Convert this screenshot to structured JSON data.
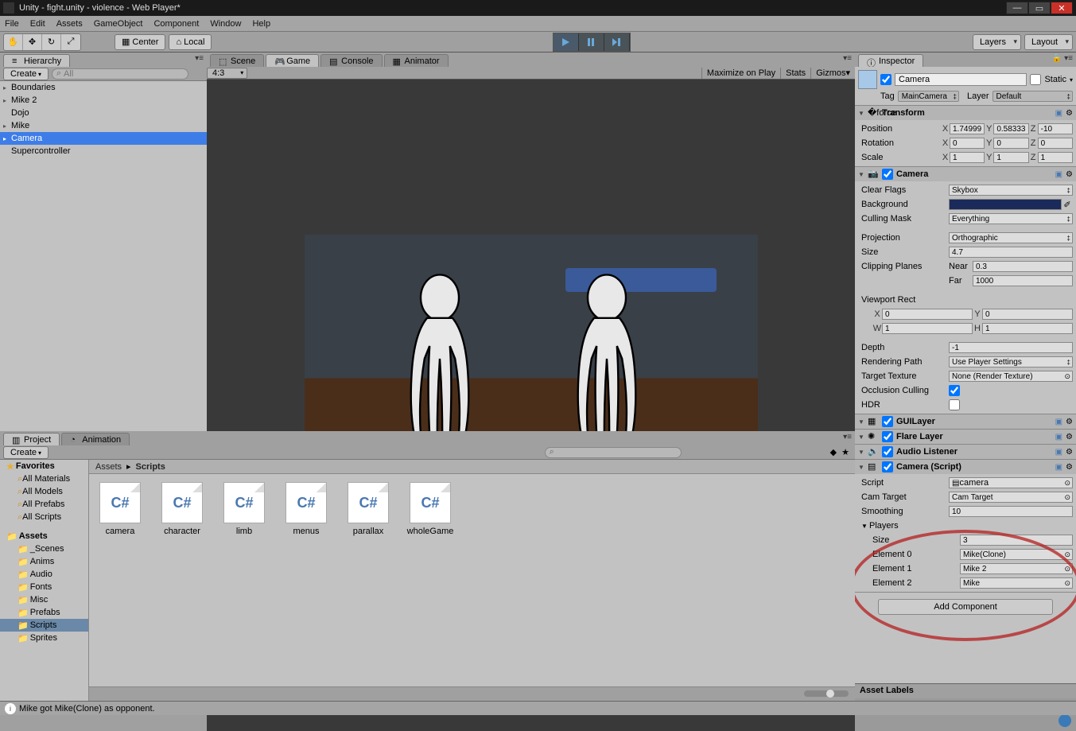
{
  "window": {
    "title": "Unity - fight.unity - violence - Web Player*",
    "btn_min": "—",
    "btn_max": "▭",
    "btn_close": "✕"
  },
  "menu": [
    "File",
    "Edit",
    "Assets",
    "GameObject",
    "Component",
    "Window",
    "Help"
  ],
  "toolbar": {
    "center": "Center",
    "local": "Local",
    "layers": "Layers",
    "layout": "Layout"
  },
  "hierarchy": {
    "tab": "Hierarchy",
    "create": "Create",
    "search_ph": "All",
    "items": [
      {
        "label": "Boundaries",
        "arrow": "▸"
      },
      {
        "label": "Mike 2",
        "arrow": "▸"
      },
      {
        "label": "Dojo",
        "arrow": ""
      },
      {
        "label": "Mike",
        "arrow": "▸"
      },
      {
        "label": "Camera",
        "arrow": "▸",
        "sel": true
      },
      {
        "label": "Supercontroller",
        "arrow": ""
      }
    ]
  },
  "tabs_mid": {
    "scene": "Scene",
    "game": "Game",
    "console": "Console",
    "animator": "Animator"
  },
  "gamebar": {
    "aspect": "4:3",
    "max": "Maximize on Play",
    "stats": "Stats",
    "gizmos": "Gizmos"
  },
  "project": {
    "tab_project": "Project",
    "tab_anim": "Animation",
    "create": "Create",
    "favorites": "Favorites",
    "favitems": [
      "All Materials",
      "All Models",
      "All Prefabs",
      "All Scripts"
    ],
    "assets": "Assets",
    "folders": [
      "_Scenes",
      "Anims",
      "Audio",
      "Fonts",
      "Misc",
      "Prefabs",
      "Scripts",
      "Sprites"
    ],
    "sel_folder": "Scripts",
    "breadcrumb": [
      "Assets",
      "Scripts"
    ],
    "files": [
      "camera",
      "character",
      "limb",
      "menus",
      "parallax",
      "wholeGame"
    ],
    "thumb": "C#"
  },
  "inspector": {
    "tab": "Inspector",
    "obj_name": "Camera",
    "static": "Static",
    "tag_lbl": "Tag",
    "tag_val": "MainCamera",
    "layer_lbl": "Layer",
    "layer_val": "Default",
    "transform": {
      "title": "Transform",
      "pos": "Position",
      "rot": "Rotation",
      "scl": "Scale",
      "px": "1.74999",
      "py": "0.58333",
      "pz": "-10",
      "rx": "0",
      "ry": "0",
      "rz": "0",
      "sx": "1",
      "sy": "1",
      "sz": "1"
    },
    "camera": {
      "title": "Camera",
      "clear_flags": "Clear Flags",
      "clear_flags_v": "Skybox",
      "background": "Background",
      "culling": "Culling Mask",
      "culling_v": "Everything",
      "projection": "Projection",
      "projection_v": "Orthographic",
      "size": "Size",
      "size_v": "4.7",
      "clip": "Clipping Planes",
      "near": "Near",
      "near_v": "0.3",
      "far": "Far",
      "far_v": "1000",
      "vrect": "Viewport Rect",
      "vx": "X",
      "vx_v": "0",
      "vy": "Y",
      "vy_v": "0",
      "vw": "W",
      "vw_v": "1",
      "vh": "H",
      "vh_v": "1",
      "depth": "Depth",
      "depth_v": "-1",
      "rpath": "Rendering Path",
      "rpath_v": "Use Player Settings",
      "ttex": "Target Texture",
      "ttex_v": "None (Render Texture)",
      "occ": "Occlusion Culling",
      "hdr": "HDR"
    },
    "guilayer": "GUILayer",
    "flarelayer": "Flare Layer",
    "audiolistener": "Audio Listener",
    "camscript": {
      "title": "Camera (Script)",
      "script": "Script",
      "script_v": "camera",
      "camtarget": "Cam Target",
      "camtarget_v": "Cam Target",
      "smoothing": "Smoothing",
      "smoothing_v": "10",
      "players": "Players",
      "size": "Size",
      "size_v": "3",
      "el0": "Element 0",
      "el0_v": "Mike(Clone)",
      "el1": "Element 1",
      "el1_v": "Mike 2",
      "el2": "Element 2",
      "el2_v": "Mike"
    },
    "addcomp": "Add Component",
    "assetlabels": "Asset Labels"
  },
  "status": "Mike got Mike(Clone) as opponent."
}
